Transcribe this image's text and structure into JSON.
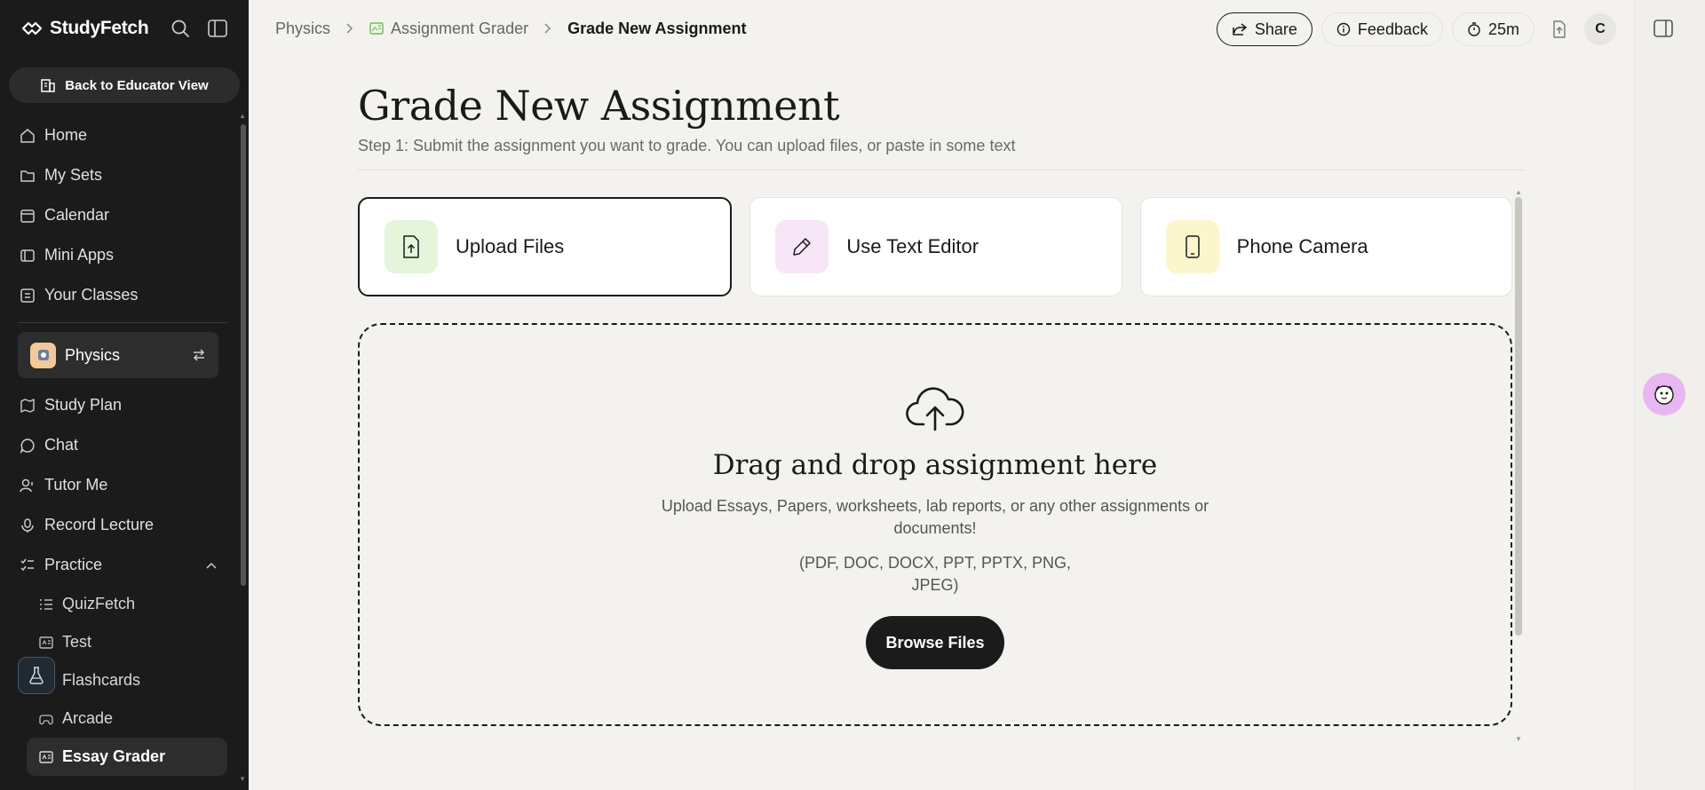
{
  "app": {
    "name": "StudyFetch"
  },
  "sidebar": {
    "back_label": "Back to Educator View",
    "nav": [
      {
        "label": "Home",
        "icon": "home-icon"
      },
      {
        "label": "My Sets",
        "icon": "folder-icon"
      },
      {
        "label": "Calendar",
        "icon": "calendar-icon"
      },
      {
        "label": "Mini Apps",
        "icon": "apps-icon"
      },
      {
        "label": "Your Classes",
        "icon": "classes-icon"
      }
    ],
    "class_name": "Physics",
    "class_nav": [
      {
        "label": "Study Plan",
        "icon": "map-icon"
      },
      {
        "label": "Chat",
        "icon": "chat-icon"
      },
      {
        "label": "Tutor Me",
        "icon": "tutor-icon"
      },
      {
        "label": "Record Lecture",
        "icon": "mic-icon"
      },
      {
        "label": "Practice",
        "icon": "practice-icon"
      }
    ],
    "practice_items": [
      {
        "label": "QuizFetch",
        "icon": "list-icon"
      },
      {
        "label": "Test",
        "icon": "test-icon"
      },
      {
        "label": "Flashcards",
        "icon": "flashcard-icon"
      },
      {
        "label": "Arcade",
        "icon": "gamepad-icon"
      },
      {
        "label": "Essay Grader",
        "icon": "grader-icon",
        "active": true
      }
    ]
  },
  "breadcrumb": {
    "items": [
      "Physics",
      "Assignment Grader"
    ],
    "current": "Grade New Assignment"
  },
  "topbar": {
    "share_label": "Share",
    "feedback_label": "Feedback",
    "timer_label": "25m",
    "avatar_initial": "C"
  },
  "main": {
    "title": "Grade New Assignment",
    "subtitle": "Step 1: Submit the assignment you want to grade. You can upload files, or paste in some text",
    "options": [
      {
        "label": "Upload Files",
        "icon": "upload-file-icon",
        "bg": "#e3f6dc",
        "selected": true
      },
      {
        "label": "Use Text Editor",
        "icon": "pencil-icon",
        "bg": "#f7e6f7",
        "selected": false
      },
      {
        "label": "Phone Camera",
        "icon": "phone-icon",
        "bg": "#fbf6cc",
        "selected": false
      }
    ],
    "dropzone": {
      "title": "Drag and drop assignment here",
      "description": "Upload Essays, Papers, worksheets, lab reports, or any other assignments or documents!",
      "formats": "(PDF, DOC, DOCX, PPT, PPTX, PNG, JPEG)",
      "button_label": "Browse Files"
    }
  }
}
